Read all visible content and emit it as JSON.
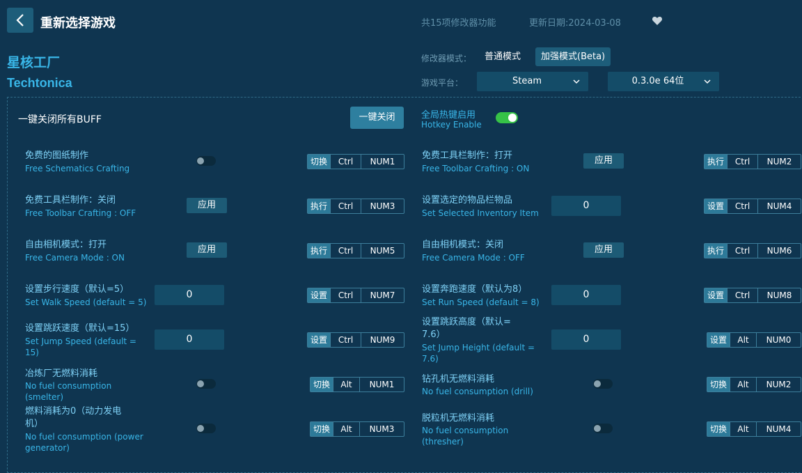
{
  "header": {
    "title": "重新选择游戏",
    "feature_count": "共15项修改器功能",
    "update_date": "更新日期:2024-03-08"
  },
  "game": {
    "name_cn": "星核工厂",
    "name_en": "Techtonica"
  },
  "mode": {
    "label": "修改器模式：",
    "normal": "普通模式",
    "enhanced": "加强模式(Beta)",
    "selected": "加强模式(Beta)"
  },
  "platform": {
    "label": "游戏平台：",
    "value": "Steam",
    "version": "0.3.0e 64位"
  },
  "buff": {
    "label": "一键关闭所有BUFF",
    "button": "一键关闭"
  },
  "hotkey": {
    "cn": "全局热键启用",
    "en": "Hotkey Enable",
    "enabled": true
  },
  "features": [
    {
      "cn": "免费的图纸制作",
      "en": "Free Schematics Crafting",
      "control": "toggle",
      "action": "切换",
      "mod": "Ctrl",
      "key": "NUM1"
    },
    {
      "cn": "免费工具栏制作：打开",
      "en": "Free Toolbar Crafting : ON",
      "control": "apply",
      "control_label": "应用",
      "action": "执行",
      "mod": "Ctrl",
      "key": "NUM2"
    },
    {
      "cn": "免费工具栏制作：关闭",
      "en": "Free Toolbar Crafting : OFF",
      "control": "apply",
      "control_label": "应用",
      "action": "执行",
      "mod": "Ctrl",
      "key": "NUM3"
    },
    {
      "cn": "设置选定的物品栏物品",
      "en": "Set Selected Inventory Item",
      "control": "input",
      "value": "0",
      "action": "设置",
      "mod": "Ctrl",
      "key": "NUM4"
    },
    {
      "cn": "自由相机模式：打开",
      "en": "Free Camera Mode : ON",
      "control": "apply",
      "control_label": "应用",
      "action": "执行",
      "mod": "Ctrl",
      "key": "NUM5"
    },
    {
      "cn": "自由相机模式：关闭",
      "en": "Free Camera Mode : OFF",
      "control": "apply",
      "control_label": "应用",
      "action": "执行",
      "mod": "Ctrl",
      "key": "NUM6"
    },
    {
      "cn": "设置步行速度（默认=5）",
      "en": "Set Walk Speed (default = 5)",
      "control": "input",
      "value": "0",
      "action": "设置",
      "mod": "Ctrl",
      "key": "NUM7"
    },
    {
      "cn": "设置奔跑速度（默认为8）",
      "en": "Set Run Speed (default = 8)",
      "control": "input",
      "value": "0",
      "action": "设置",
      "mod": "Ctrl",
      "key": "NUM8"
    },
    {
      "cn": "设置跳跃速度（默认=15）",
      "en_l1": "Set Jump Speed (default =",
      "en_l2": "15)",
      "control": "input",
      "value": "0",
      "action": "设置",
      "mod": "Ctrl",
      "key": "NUM9"
    },
    {
      "cn_l1": "设置跳跃高度（默认=",
      "cn_l2": "7.6）",
      "en_l1": "Set Jump Height (default =",
      "en_l2": "7.6)",
      "control": "input",
      "value": "0",
      "action": "设置",
      "mod": "Alt",
      "key": "NUM0"
    },
    {
      "cn": "冶炼厂无燃料消耗",
      "en_l1": "No fuel consumption",
      "en_l2": "(smelter)",
      "control": "toggle",
      "action": "切换",
      "mod": "Alt",
      "key": "NUM1"
    },
    {
      "cn": "钻孔机无燃料消耗",
      "en": "No fuel consumption (drill)",
      "control": "toggle",
      "action": "切换",
      "mod": "Alt",
      "key": "NUM2"
    },
    {
      "cn_l1": "燃料消耗为0（动力发电",
      "cn_l2": "机）",
      "en_l1": "No fuel consumption (power",
      "en_l2": "generator)",
      "control": "toggle",
      "action": "切换",
      "mod": "Alt",
      "key": "NUM3"
    },
    {
      "cn": "脱粒机无燃料消耗",
      "en_l1": "No fuel consumption",
      "en_l2": "(thresher)",
      "control": "toggle",
      "action": "切换",
      "mod": "Alt",
      "key": "NUM4"
    }
  ],
  "colors": {
    "background": "#0f3550",
    "accent": "#39b6e8",
    "toggle_on": "#36c247",
    "button": "#1d5d7a"
  }
}
